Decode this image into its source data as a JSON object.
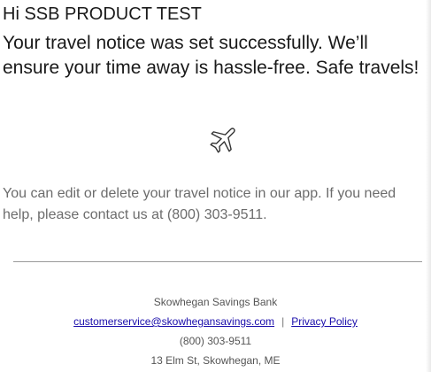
{
  "greeting": "Hi SSB PRODUCT TEST",
  "headline": "Your travel notice was set successfully. We’ll ensure your time away is hassle-free. Safe travels!",
  "icon": "airplane-icon",
  "body_text": "You can edit or delete your travel notice in our app. If you need help, please contact us at (800) 303-9511.",
  "footer": {
    "bank_name": "Skowhegan Savings Bank",
    "email_link": "customerservice@skowhegansavings.com",
    "separator": "|",
    "privacy_link": "Privacy Policy",
    "phone": "(800) 303-9511",
    "address": "13 Elm St, Skowhegan, ME"
  },
  "colors": {
    "link": "#1a0dab",
    "body_text": "#6c6c6c",
    "heading": "#1a1a1a"
  }
}
